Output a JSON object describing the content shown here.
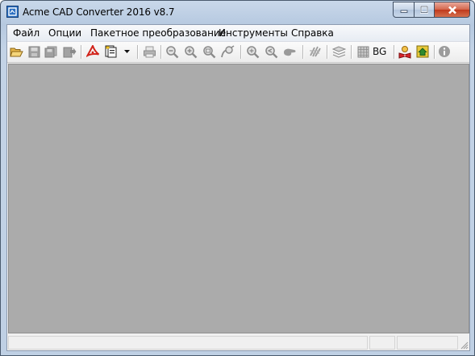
{
  "window": {
    "title": "Acme CAD Converter 2016 v8.7"
  },
  "menu": {
    "items": [
      "Файл",
      "Опции",
      "Пакетное преобразование",
      "Инструменты",
      "Справка"
    ]
  },
  "toolbar": {
    "bg_label": "BG",
    "icons": [
      "open-folder-icon",
      "save-icon",
      "save-as-icon",
      "export-icon",
      "pdf-convert-icon",
      "batch-convert-icon",
      "dropdown-arrow-icon",
      "print-icon",
      "zoom-out-icon",
      "zoom-in-icon",
      "zoom-window-icon",
      "zoom-extents-icon",
      "zoom-realtime-icon",
      "zoom-previous-icon",
      "pan-icon",
      "layer-icon",
      "layers-icon",
      "grid-icon",
      "help-book-icon",
      "home-icon",
      "info-icon"
    ]
  },
  "colors": {
    "canvas": "#ababab",
    "titlebar": "#c9d8ea",
    "close_button": "#c0391c"
  }
}
